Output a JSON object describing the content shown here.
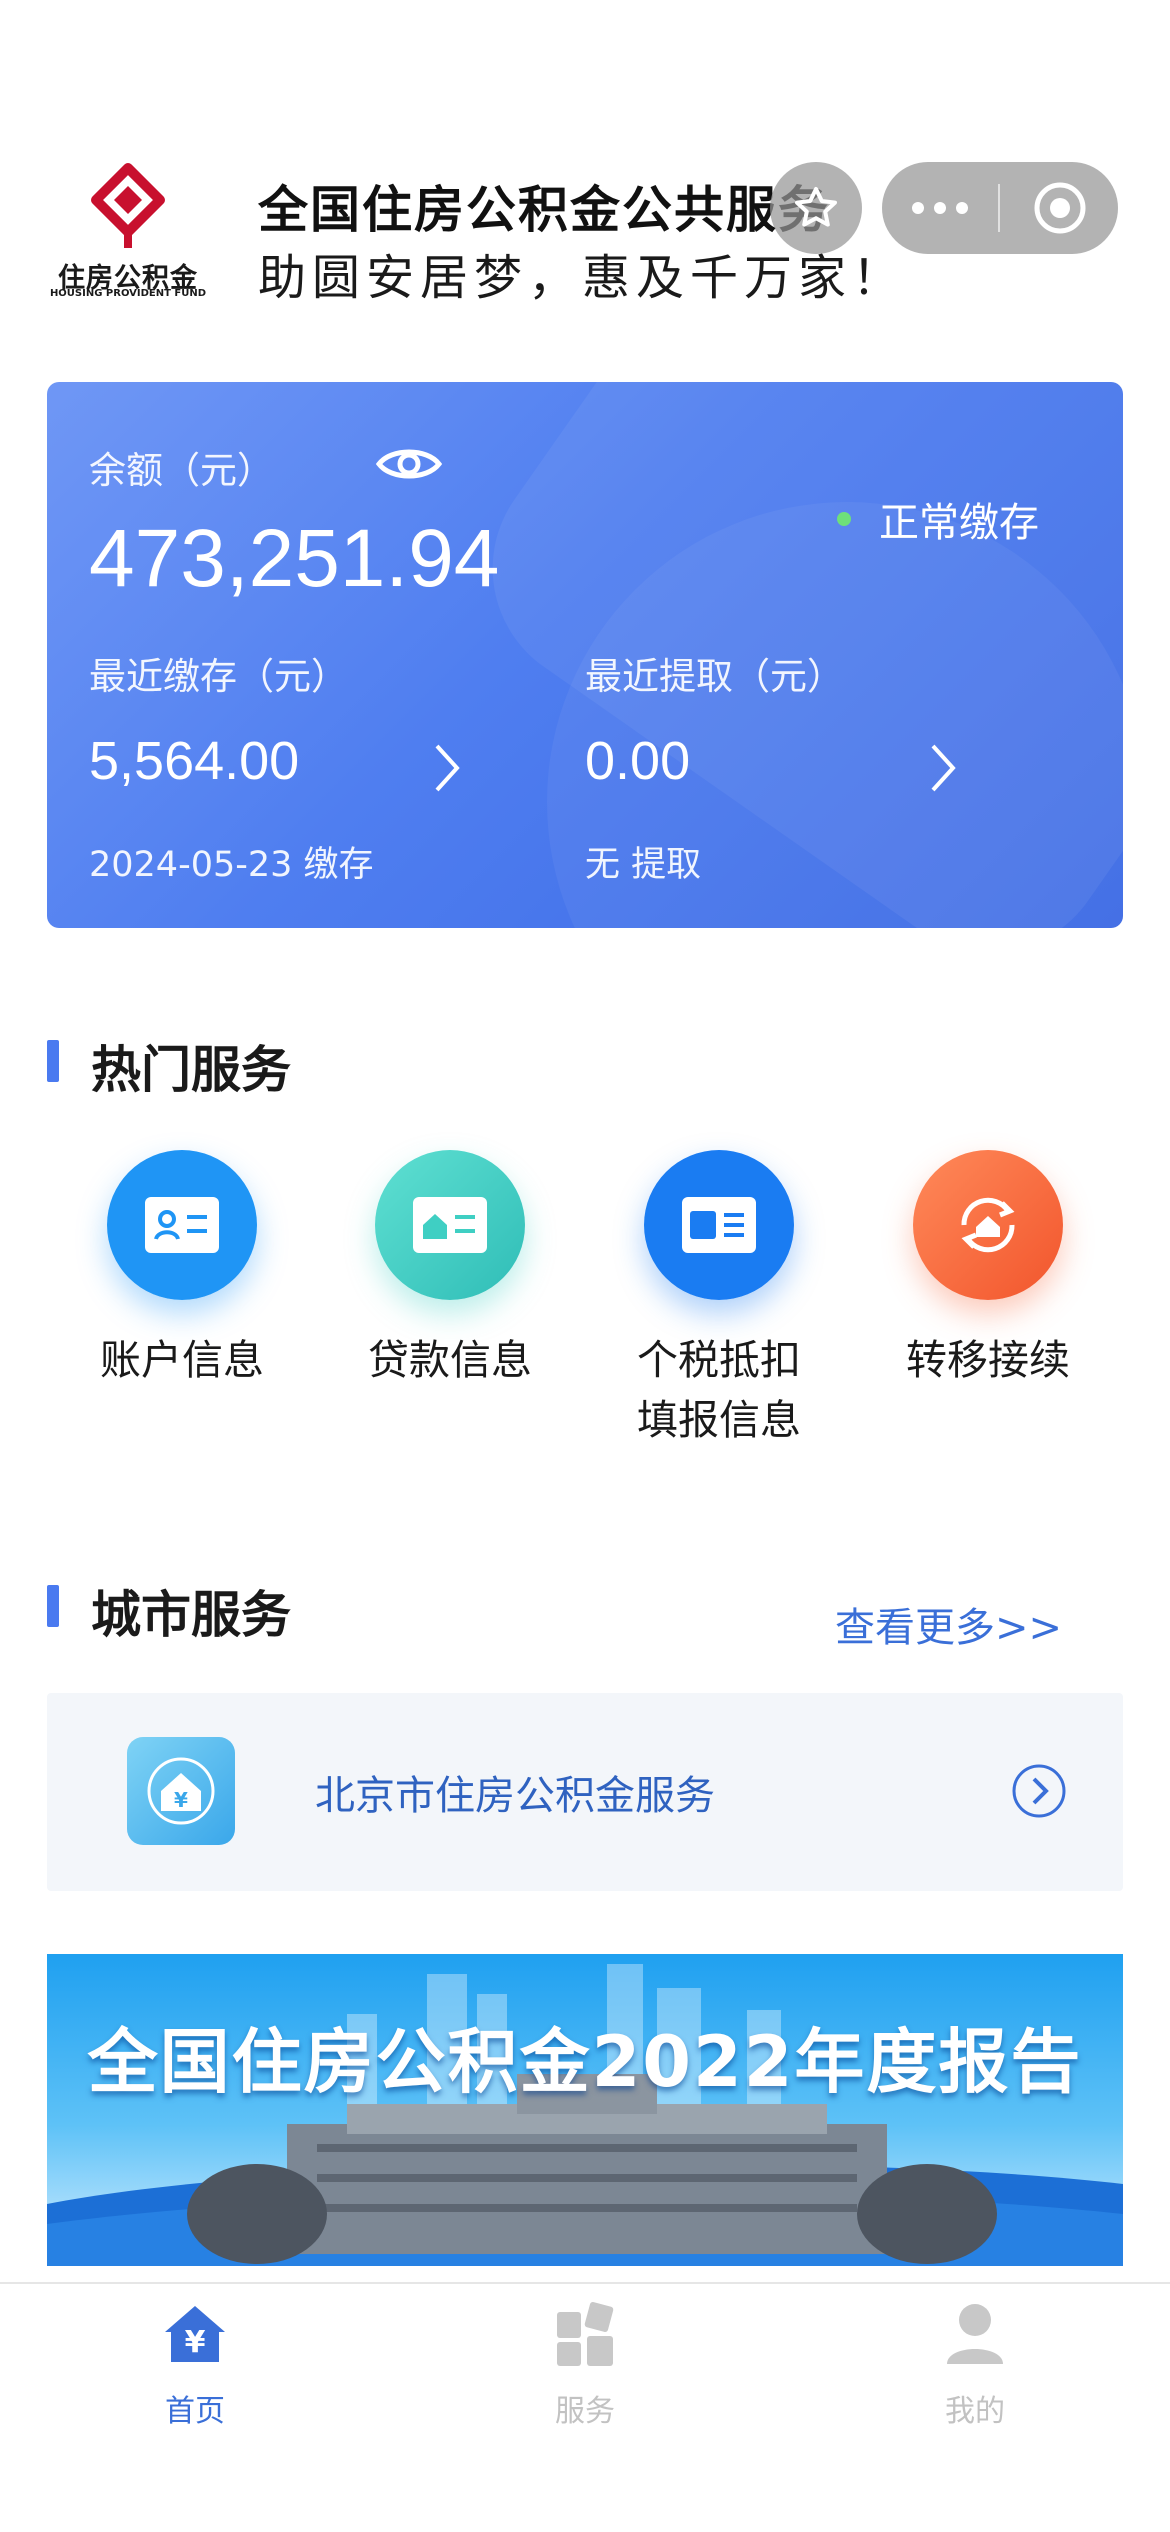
{
  "header": {
    "logo_text_cn": "住房公积金",
    "logo_text_en": "HOUSING PROVIDENT FUND",
    "title": "全国住房公积金公共服务",
    "slogan": "助圆安居梦，惠及千万家！"
  },
  "account_card": {
    "balance_label": "余额（元）",
    "balance_value": "473,251.94",
    "status": "正常缴存",
    "recent_deposit_label": "最近缴存（元）",
    "recent_deposit_value": "5,564.00",
    "recent_deposit_note": "2024-05-23 缴存",
    "recent_withdraw_label": "最近提取（元）",
    "recent_withdraw_value": "0.00",
    "recent_withdraw_note": "无 提取"
  },
  "hot_services": {
    "title": "热门服务",
    "items": [
      {
        "label": "账户信息",
        "icon": "account-card-icon",
        "color": "#1f95f5"
      },
      {
        "label": "贷款信息",
        "icon": "loan-house-card-icon",
        "color": "#3fcfc3"
      },
      {
        "label_line1": "个税抵扣",
        "label_line2": "填报信息",
        "icon": "tax-card-icon",
        "color": "#1a7cf2"
      },
      {
        "label": "转移接续",
        "icon": "transfer-house-icon",
        "color": "#f56a3e"
      }
    ]
  },
  "city_services": {
    "title": "城市服务",
    "more": "查看更多>>",
    "item_label": "北京市住房公积金服务"
  },
  "banner": {
    "text": "全国住房公积金2022年度报告"
  },
  "tabbar": {
    "items": [
      {
        "label": "首页",
        "icon": "home-yuan-icon",
        "active": true
      },
      {
        "label": "服务",
        "icon": "services-grid-icon",
        "active": false
      },
      {
        "label": "我的",
        "icon": "user-icon",
        "active": false
      }
    ],
    "active_color": "#3a6fd8",
    "inactive_color": "#c2c2c2"
  }
}
